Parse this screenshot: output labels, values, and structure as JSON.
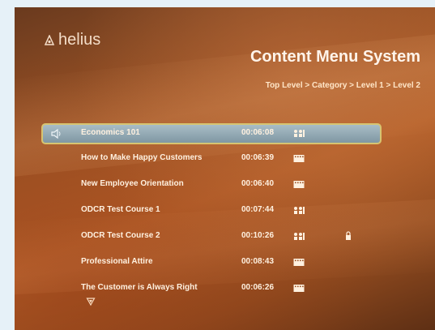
{
  "app": {
    "logo_text": "helius",
    "title": "Content Menu System",
    "breadcrumb": "Top Level > Category > Level 1 > Level 2"
  },
  "menu": {
    "selected_index": 0,
    "items": [
      {
        "name": "Economics 101",
        "duration": "00:06:08",
        "format_icon": "people-icon",
        "locked": false
      },
      {
        "name": "How to Make Happy Customers",
        "duration": "00:06:39",
        "format_icon": "film-icon",
        "locked": false
      },
      {
        "name": "New Employee Orientation",
        "duration": "00:06:40",
        "format_icon": "film-icon",
        "locked": false
      },
      {
        "name": "ODCR Test Course 1",
        "duration": "00:07:44",
        "format_icon": "people-icon",
        "locked": false
      },
      {
        "name": "ODCR Test Course 2",
        "duration": "00:10:26",
        "format_icon": "people-icon",
        "locked": true
      },
      {
        "name": "Professional Attire",
        "duration": "00:08:43",
        "format_icon": "film-icon",
        "locked": false
      },
      {
        "name": "The Customer is Always Right",
        "duration": "00:06:26",
        "format_icon": "film-icon",
        "locked": false
      }
    ]
  },
  "colors": {
    "background": "#b8632c",
    "highlight": "#8ea7b3",
    "highlight_border": "#d7c470",
    "text": "#fff1e0"
  }
}
